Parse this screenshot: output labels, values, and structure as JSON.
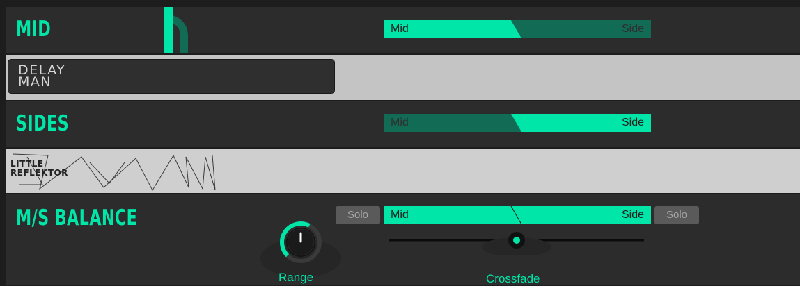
{
  "accent": "#00e6a8",
  "mid_row": {
    "title": "MID",
    "switch_left": "Mid",
    "switch_right": "Side",
    "active": "Mid"
  },
  "delay_slot": {
    "plugin_line1": "DELAY",
    "plugin_line2": "MAN"
  },
  "sides_row": {
    "title": "SIDES",
    "switch_left": "Mid",
    "switch_right": "Side",
    "active": "Side"
  },
  "reflektor_slot": {
    "plugin_line1": "LITTLE",
    "plugin_line2": "REFLEKTOR"
  },
  "balance_row": {
    "title": "M/S BALANCE",
    "solo_left": "Solo",
    "solo_right": "Solo",
    "switch_left": "Mid",
    "switch_right": "Side",
    "range_label": "Range",
    "range_value": 0.6,
    "crossfade_label": "Crossfade",
    "crossfade_value": 0.5
  }
}
